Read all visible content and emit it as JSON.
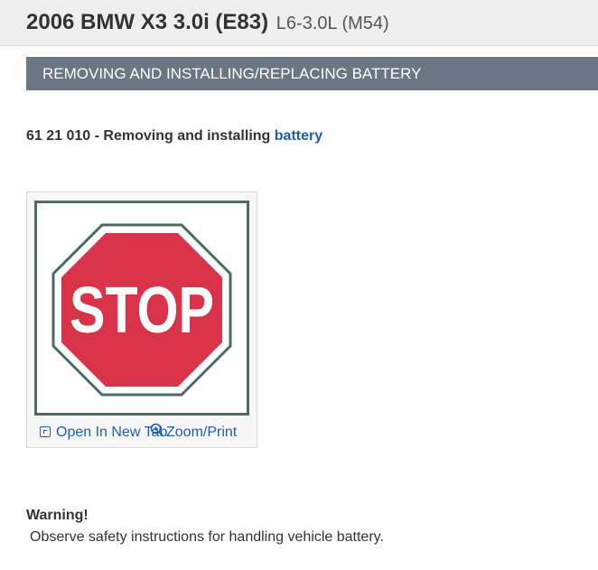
{
  "header": {
    "vehicle_model": "2006 BMW X3 3.0i (E83)",
    "engine": "L6-3.0L (M54)"
  },
  "section": {
    "title": "REMOVING AND INSTALLING/REPLACING BATTERY"
  },
  "procedure": {
    "prefix": "61 21 010 - Removing and installing",
    "link_text": "battery"
  },
  "figure": {
    "sign_text": "STOP",
    "open_new_tab_label": "Open In New Tab",
    "zoom_print_label": "Zoom/Print",
    "icons": [
      "open-new-tab-icon",
      "zoom-icon"
    ],
    "colors": {
      "sign_red": "#d9334a",
      "sign_border": "#4d6b63"
    }
  },
  "warning": {
    "title": "Warning!",
    "text": "Observe safety instructions for handling vehicle battery."
  },
  "colors": {
    "section_bar": "#6b7583",
    "link": "#1f5fa6",
    "header_bg": "#eeeeee"
  }
}
